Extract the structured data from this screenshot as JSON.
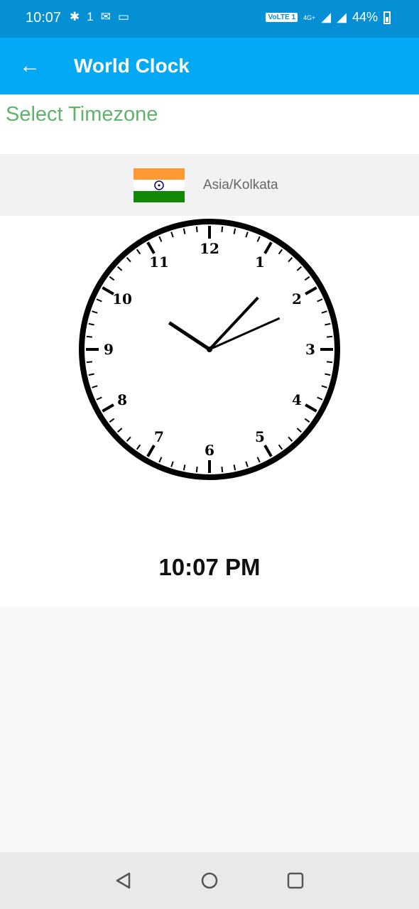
{
  "status_bar": {
    "time": "10:07",
    "left_icons": [
      "slack-icon",
      "one-icon",
      "gmail-icon",
      "laptop-icon"
    ],
    "volte": "VoLTE 1",
    "network": "4G+",
    "battery": "44%"
  },
  "app_bar": {
    "title": "World Clock",
    "back_icon": "arrow-left-icon"
  },
  "select_label": "Select Timezone",
  "timezone": {
    "name": "Asia/Kolkata",
    "flag": "india-flag"
  },
  "clock": {
    "hour": 10,
    "minute": 7,
    "second": 11,
    "numerals": [
      "12",
      "1",
      "2",
      "3",
      "4",
      "5",
      "6",
      "7",
      "8",
      "9",
      "10",
      "11"
    ]
  },
  "digital_time": "10:07 PM",
  "nav": {
    "back": "back-triangle-icon",
    "home": "home-circle-icon",
    "recents": "recents-square-icon"
  },
  "colors": {
    "status_bar": "#0590d6",
    "app_bar": "#03a9f4",
    "accent_green": "#5fb36b"
  }
}
